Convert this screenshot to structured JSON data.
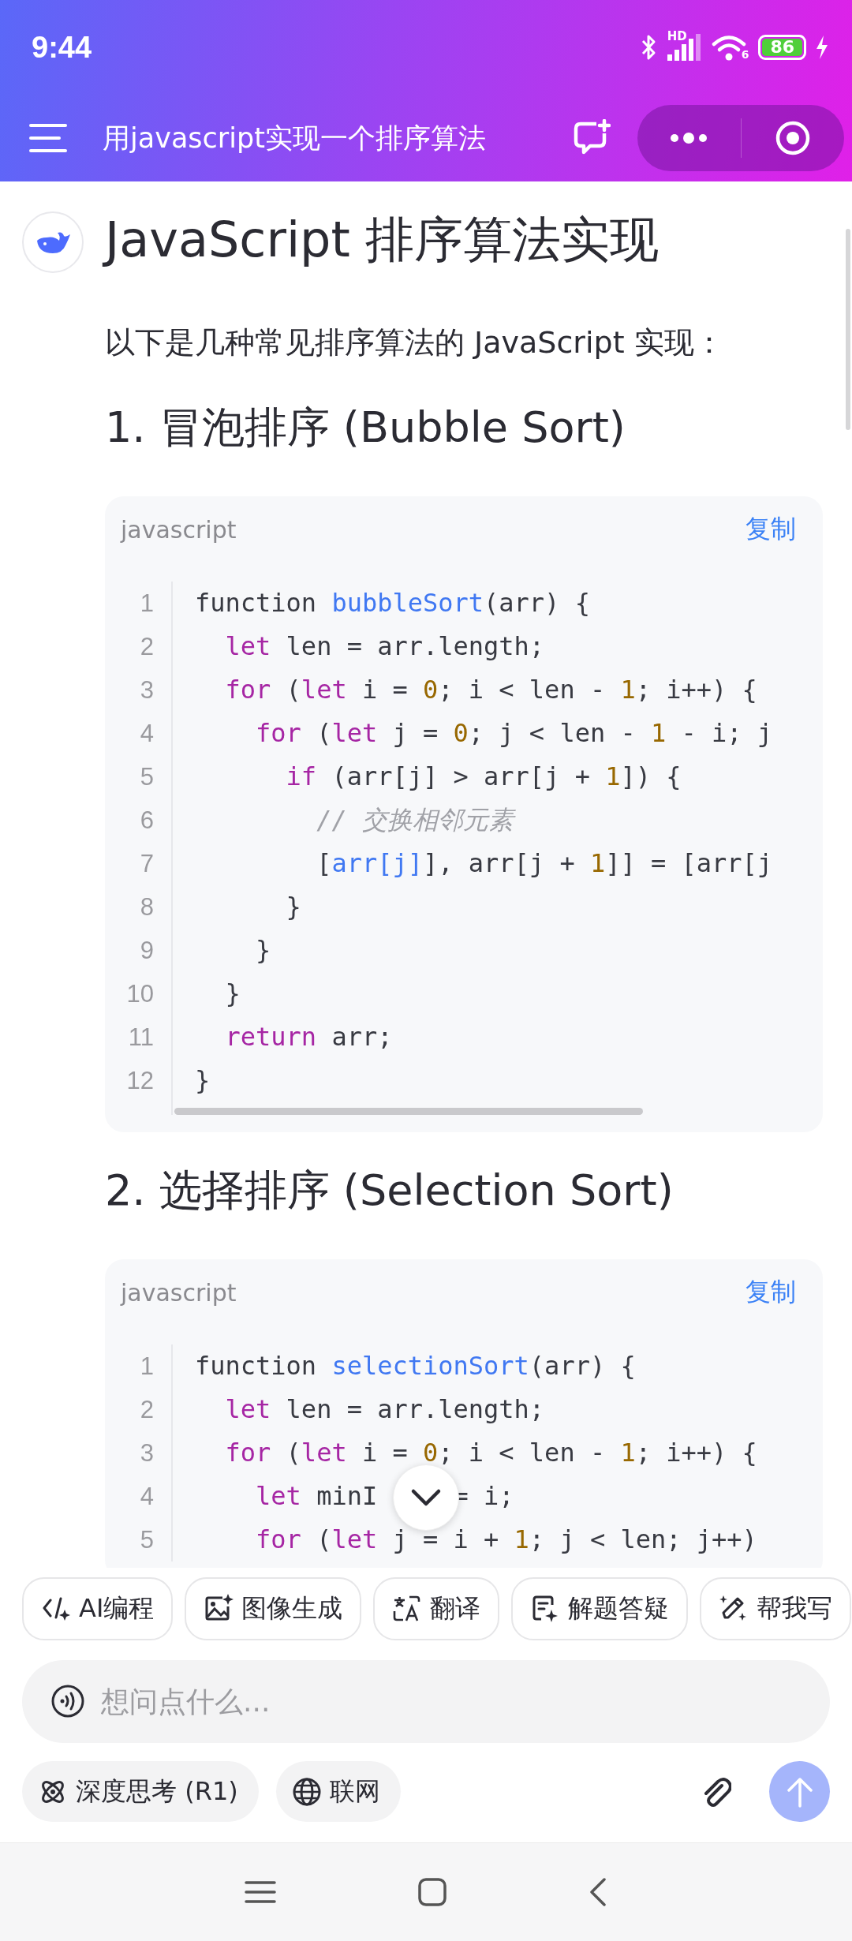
{
  "status_bar": {
    "time": "9:44",
    "network_label": "HD",
    "wifi_label": "6",
    "battery": "86",
    "charging": true
  },
  "app_bar": {
    "title": "用javascript实现一个排序算法"
  },
  "message": {
    "title": "JavaScript 排序算法实现",
    "intro": "以下是几种常见排序算法的 JavaScript 实现：",
    "sections": [
      {
        "heading": "1. 冒泡排序 (Bubble Sort)",
        "code": {
          "language": "javascript",
          "copy_label": "复制",
          "horizontal_scroll": true,
          "lines": [
            {
              "number": "1",
              "tokens": [
                {
                  "kind": "plain",
                  "text": "function "
                },
                {
                  "kind": "function",
                  "text": "bubbleSort"
                },
                {
                  "kind": "plain",
                  "text": "(arr) {"
                }
              ]
            },
            {
              "number": "2",
              "tokens": [
                {
                  "kind": "keyword",
                  "text": "  let"
                },
                {
                  "kind": "plain",
                  "text": " len = arr.length;"
                }
              ]
            },
            {
              "number": "3",
              "tokens": [
                {
                  "kind": "keyword",
                  "text": "  for"
                },
                {
                  "kind": "plain",
                  "text": " ("
                },
                {
                  "kind": "keyword",
                  "text": "let"
                },
                {
                  "kind": "plain",
                  "text": " i = "
                },
                {
                  "kind": "number",
                  "text": "0"
                },
                {
                  "kind": "plain",
                  "text": "; i < len - "
                },
                {
                  "kind": "number",
                  "text": "1"
                },
                {
                  "kind": "plain",
                  "text": "; i++) {"
                }
              ]
            },
            {
              "number": "4",
              "tokens": [
                {
                  "kind": "keyword",
                  "text": "    for"
                },
                {
                  "kind": "plain",
                  "text": " ("
                },
                {
                  "kind": "keyword",
                  "text": "let"
                },
                {
                  "kind": "plain",
                  "text": " j = "
                },
                {
                  "kind": "number",
                  "text": "0"
                },
                {
                  "kind": "plain",
                  "text": "; j < len - "
                },
                {
                  "kind": "number",
                  "text": "1"
                },
                {
                  "kind": "plain",
                  "text": " - i; j"
                }
              ]
            },
            {
              "number": "5",
              "tokens": [
                {
                  "kind": "keyword",
                  "text": "      if"
                },
                {
                  "kind": "plain",
                  "text": " (arr[j] > arr[j + "
                },
                {
                  "kind": "number",
                  "text": "1"
                },
                {
                  "kind": "plain",
                  "text": "]) {"
                }
              ]
            },
            {
              "number": "6",
              "tokens": [
                {
                  "kind": "comment",
                  "text": "        // 交换相邻元素"
                }
              ]
            },
            {
              "number": "7",
              "tokens": [
                {
                  "kind": "plain",
                  "text": "        ["
                },
                {
                  "kind": "variable",
                  "text": "arr[j]"
                },
                {
                  "kind": "plain",
                  "text": "], arr[j + "
                },
                {
                  "kind": "number",
                  "text": "1"
                },
                {
                  "kind": "plain",
                  "text": "]] = [arr[j"
                }
              ]
            },
            {
              "number": "8",
              "tokens": [
                {
                  "kind": "plain",
                  "text": "      }"
                }
              ]
            },
            {
              "number": "9",
              "tokens": [
                {
                  "kind": "plain",
                  "text": "    }"
                }
              ]
            },
            {
              "number": "10",
              "tokens": [
                {
                  "kind": "plain",
                  "text": "  }"
                }
              ]
            },
            {
              "number": "11",
              "tokens": [
                {
                  "kind": "keyword",
                  "text": "  return"
                },
                {
                  "kind": "plain",
                  "text": " arr;"
                }
              ]
            },
            {
              "number": "12",
              "tokens": [
                {
                  "kind": "plain",
                  "text": "}"
                }
              ]
            }
          ]
        }
      },
      {
        "heading": "2. 选择排序 (Selection Sort)",
        "code": {
          "language": "javascript",
          "copy_label": "复制",
          "horizontal_scroll": false,
          "lines": [
            {
              "number": "1",
              "tokens": [
                {
                  "kind": "plain",
                  "text": "function "
                },
                {
                  "kind": "function",
                  "text": "selectionSort"
                },
                {
                  "kind": "plain",
                  "text": "(arr) {"
                }
              ]
            },
            {
              "number": "2",
              "tokens": [
                {
                  "kind": "keyword",
                  "text": "  let"
                },
                {
                  "kind": "plain",
                  "text": " len = arr.length;"
                }
              ]
            },
            {
              "number": "3",
              "tokens": [
                {
                  "kind": "keyword",
                  "text": "  for"
                },
                {
                  "kind": "plain",
                  "text": " ("
                },
                {
                  "kind": "keyword",
                  "text": "let"
                },
                {
                  "kind": "plain",
                  "text": " i = "
                },
                {
                  "kind": "number",
                  "text": "0"
                },
                {
                  "kind": "plain",
                  "text": "; i < len - "
                },
                {
                  "kind": "number",
                  "text": "1"
                },
                {
                  "kind": "plain",
                  "text": "; i++) {"
                }
              ]
            },
            {
              "number": "4",
              "tokens": [
                {
                  "kind": "keyword",
                  "text": "    let"
                },
                {
                  "kind": "plain",
                  "text": " minI"
                },
                {
                  "kind": "after_cover",
                  "text": "= i;"
                }
              ]
            },
            {
              "number": "5",
              "tokens": [
                {
                  "kind": "keyword",
                  "text": "    for"
                },
                {
                  "kind": "plain",
                  "text": " ("
                },
                {
                  "kind": "keyword",
                  "text": "let"
                },
                {
                  "kind": "plain",
                  "text": " j = i + "
                },
                {
                  "kind": "number",
                  "text": "1"
                },
                {
                  "kind": "plain",
                  "text": "; j < len; j++)"
                }
              ]
            }
          ]
        }
      }
    ]
  },
  "shortcuts": [
    {
      "kind": "code",
      "label": "AI编程"
    },
    {
      "kind": "image",
      "label": "图像生成"
    },
    {
      "kind": "translate",
      "label": "翻译"
    },
    {
      "kind": "solve",
      "label": "解题答疑"
    },
    {
      "kind": "write",
      "label": "帮我写"
    }
  ],
  "composer": {
    "placeholder": "想问点什么...",
    "toggles": [
      {
        "kind": "deep_think",
        "label": "深度思考 (R1)",
        "selected": false
      },
      {
        "kind": "web",
        "label": "联网",
        "selected": false
      }
    ],
    "send_disabled": true
  }
}
